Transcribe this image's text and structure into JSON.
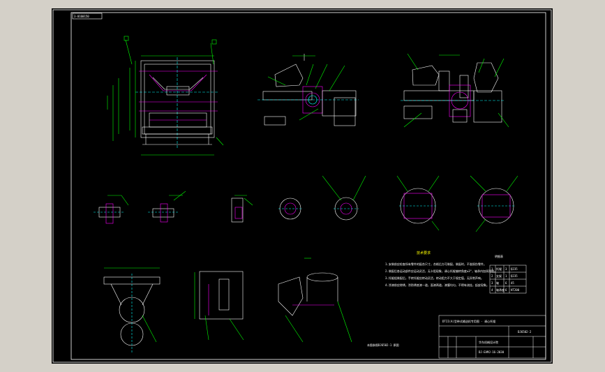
{
  "drawing": {
    "tag": "3-0160150",
    "tech_heading": "技术要求",
    "tech_notes": [
      "1.安装前应检查所有零件的配合尺寸，合格后方可装配，装配时，不准损伤零件。",
      "2.装配后各运动部件应运动灵活，无卡阻现象，调心托辊偏转角度±3°，轴承内加润滑脂。",
      "3.托辊组装配后，手转托辊应转动灵活，转动阻力不大于规定值，无异常声响。",
      "4.涂漆前应除锈，涂防锈底漆一道，面漆两道，漆膜均匀，不得有流挂，起皮现象。"
    ],
    "table_title": "明细表",
    "table_rows": [
      [
        "1",
        "托辊",
        "3",
        "Q235"
      ],
      [
        "2",
        "支架",
        "1",
        "Q235"
      ],
      [
        "3",
        "轴",
        "6",
        "45"
      ],
      [
        "4",
        "轴承座",
        "6",
        "HT200"
      ]
    ],
    "title_block": {
      "name": "DTII(A)型带式输送机专用图 - 调心托辊",
      "drawing_no": "DJ6502-2",
      "company": "华东机械设计院",
      "code": "DJ-EAMJ-16-2030"
    },
    "bottom_note": "本图参照DJ6502-1 原图"
  },
  "colors": {
    "background": "#000000",
    "outline": "#ffffff",
    "dimension": "#00ff00",
    "part": "#ff00ff",
    "center": "#00ffff",
    "text": "#ffff00",
    "frame": "#ffffff"
  }
}
